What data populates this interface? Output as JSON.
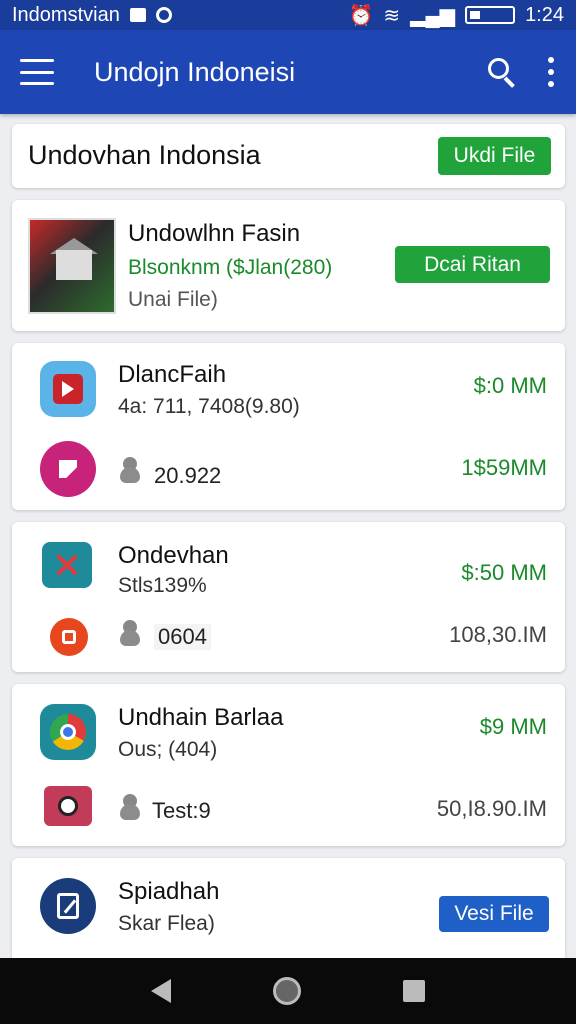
{
  "status_bar": {
    "carrier": "Indomstvian",
    "time": "1:24"
  },
  "app_bar": {
    "title": "Undojn Indoneisi"
  },
  "header_card": {
    "title": "Undovhan Indonsia",
    "button_label": "Ukdi File"
  },
  "featured": {
    "name": "Undowlhn Fasin",
    "price_line": "Blsonknm  ($Jlan(280)",
    "sub": "Unai File)",
    "button_label": "Dcai Ritan"
  },
  "cards": [
    {
      "name": "DlancFaih",
      "sub": "4a: 711, 7408(9.80)",
      "price": "$:0 MM",
      "count": "20.922",
      "size": "1$59MM"
    },
    {
      "name": "Ondevhan",
      "sub": "Stls139%",
      "price": "$:50 MM",
      "count": "0604",
      "size": "108,30.IM"
    },
    {
      "name": "Undhain Barlaa",
      "sub": "Ous; (404)",
      "price": "$9 MM",
      "count": "Test:9",
      "size": "50,I8.90.IM"
    }
  ],
  "last_card": {
    "name": "Spiadhah",
    "sub": "Skar Flea)",
    "button_label": "Vesi File"
  },
  "colors": {
    "status_bar": "#1a3c9a",
    "app_bar": "#1e46b4",
    "accent_green": "#1fa33a",
    "accent_blue": "#1f5fc8",
    "price_green": "#1a8a2a"
  }
}
